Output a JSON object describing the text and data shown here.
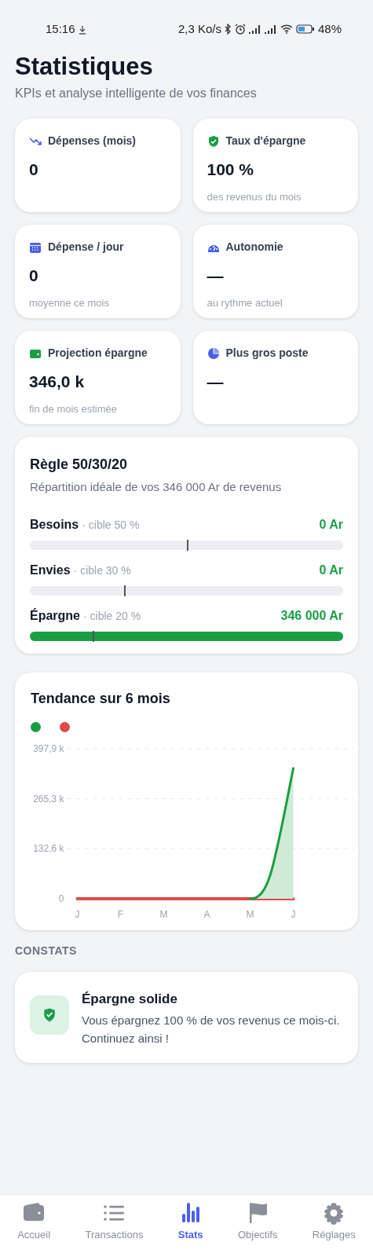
{
  "status_bar": {
    "time": "15:16",
    "speed": "2,3 Ko/s",
    "battery": "48%"
  },
  "header": {
    "title": "Statistiques",
    "subtitle": "KPIs et analyse intelligente de vos finances"
  },
  "kpis": [
    {
      "label": "Dépenses (mois)",
      "value": "0"
    },
    {
      "label": "Taux d'épargne",
      "value": "100 %",
      "note": "des revenus du mois"
    },
    {
      "label": "Dépense / jour",
      "value": "0",
      "note": "moyenne ce mois"
    },
    {
      "label": "Autonomie",
      "value": "—",
      "note": "au rythme actuel"
    },
    {
      "label": "Projection épargne",
      "value": "346,0 k",
      "note": "fin de mois estimée"
    },
    {
      "label": "Plus gros poste",
      "value": "—"
    }
  ],
  "rule_card": {
    "title": "Règle 50/30/20",
    "subtitle": "Répartition idéale de vos 346 000 Ar de revenus",
    "rows": [
      {
        "name": "Besoins",
        "target_text": "· cible 50 %",
        "amount": "0 Ar",
        "target": {
          "level": 0.5
        }
      },
      {
        "name": "Envies",
        "target_text": "· cible 30 %",
        "amount": "0 Ar",
        "target": {
          "level": 0.3
        }
      },
      {
        "name": "Épargne",
        "target_text": "· cible 20 %",
        "amount": "346 000 Ar",
        "level": 1,
        "target": {
          "level": 0.2
        }
      }
    ]
  },
  "trend_card": {
    "title": "Tendance sur 6 mois",
    "chart_data": {
      "type": "line",
      "categories": [
        "J",
        "F",
        "M",
        "A",
        "M",
        "J"
      ],
      "series": [
        {
          "color": "#1a9e45",
          "values": [
            null,
            null,
            null,
            null,
            0,
            346
          ]
        },
        {
          "color": "#e04a4a",
          "values": [
            0,
            0,
            0,
            0,
            0,
            0
          ]
        }
      ],
      "ylim": [
        0,
        397.9
      ],
      "yticks": [
        {
          "value": 0,
          "label": "0"
        },
        {
          "value": 132.6,
          "label": "132,6 k"
        },
        {
          "value": 265.3,
          "label": "265,3 k"
        },
        {
          "value": 397.9,
          "label": "397,9 k"
        }
      ]
    }
  },
  "insights_heading": "CONSTATS",
  "insights": [
    {
      "title": "Épargne solide",
      "text": "Vous épargnez 100 % de vos revenus ce mois-ci. Continuez ainsi !"
    }
  ],
  "bottom_nav": [
    {
      "label": "Accueil",
      "selected": false
    },
    {
      "label": "Transactions",
      "selected": false
    },
    {
      "label": "Stats",
      "selected": true
    },
    {
      "label": "Objectifs",
      "selected": false
    },
    {
      "label": "Réglages",
      "selected": false
    }
  ]
}
